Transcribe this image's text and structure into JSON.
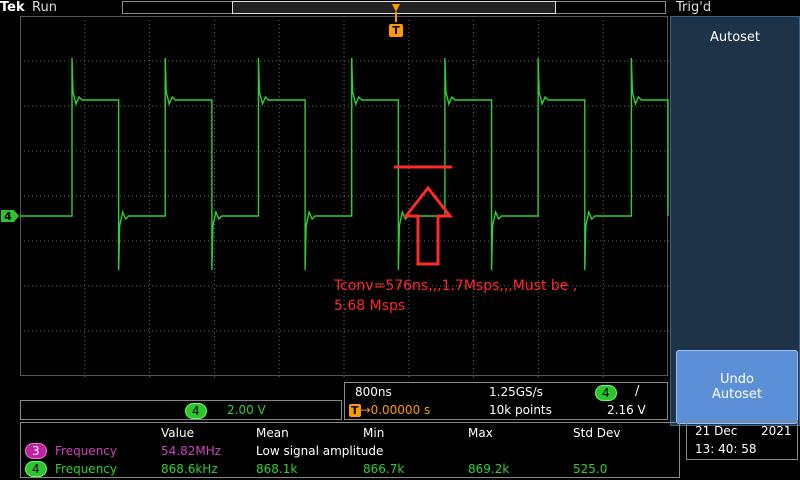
{
  "header": {
    "brand": "Tek",
    "run_state": "Run",
    "trigger_state": "Trig'd",
    "trigger_marker": "T"
  },
  "channel_marker": "4",
  "side_panel": {
    "autoset_label": "Autoset",
    "undo_label_line1": "Undo",
    "undo_label_line2": "Autoset"
  },
  "channel_scale": {
    "channel": "4",
    "volts_per_div": "2.00 V"
  },
  "timebase": {
    "time_per_div": "800ns",
    "sample_rate": "1.25GS/s",
    "trigger_channel": "4",
    "trigger_slope": "/",
    "position_marker": "T",
    "position_arrow": "→",
    "position": "0.00000 s",
    "record_length": "10k points",
    "trigger_level": "2.16 V"
  },
  "measurements": {
    "headers": [
      "Value",
      "Mean",
      "Min",
      "Max",
      "Std Dev"
    ],
    "rows": [
      {
        "channel": "3",
        "name": "Frequency",
        "value": "54.82MHz",
        "mean": "Low signal amplitude",
        "min": "",
        "max": "",
        "std": ""
      },
      {
        "channel": "4",
        "name": "Frequency",
        "value": "868.6kHz",
        "mean": "868.1k",
        "min": "866.7k",
        "max": "869.2k",
        "std": "525.0"
      }
    ]
  },
  "datetime": {
    "day_month": "21 Dec",
    "year": "2021",
    "time": "13: 40: 58"
  },
  "annotation": {
    "line1": "Tconv=576ns,,,1.7Msps,,,Must be ,",
    "line2": "5.68 Msps"
  },
  "colors": {
    "trace": "#2fd02f",
    "annotation": "#ff2a2a",
    "trigger": "#ff9900",
    "side_panel": "#1e3348",
    "undo_button": "#5b8fd8"
  },
  "signal": {
    "period_ns": 1151,
    "high_time_ns": 576,
    "icons": [
      "trigger-marker-icon",
      "ground-marker-icon",
      "up-arrow-icon"
    ]
  }
}
